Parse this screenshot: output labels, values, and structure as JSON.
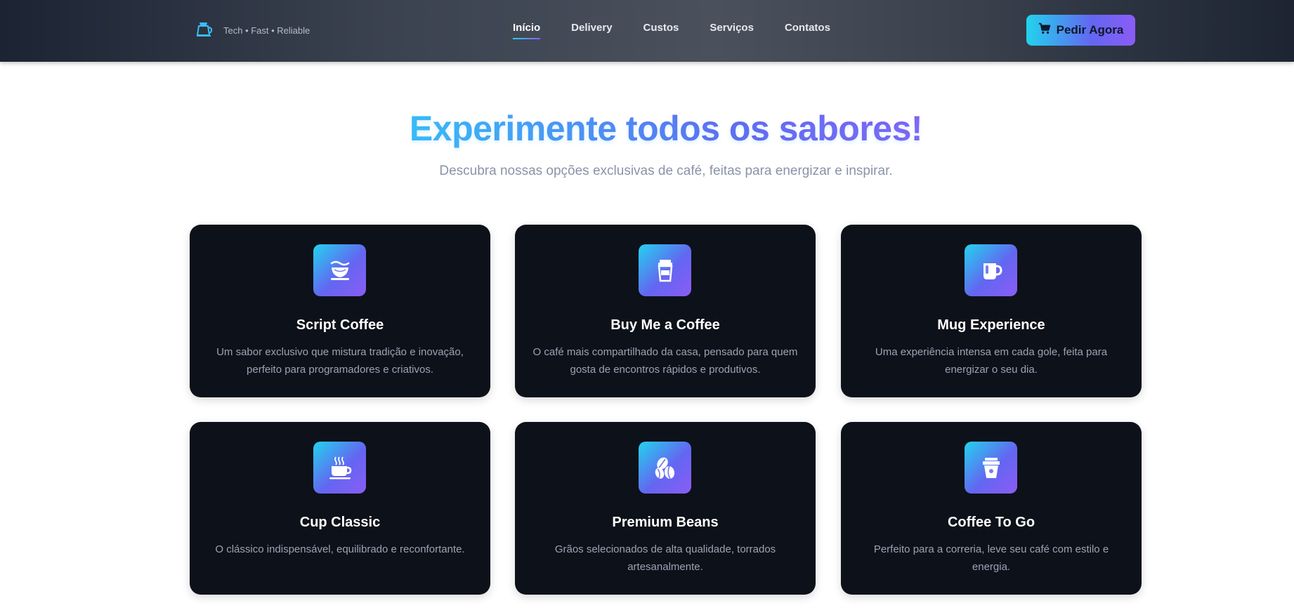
{
  "header": {
    "logo_icon": "coffee-pot-icon",
    "tagline": "Tech • Fast • Reliable",
    "nav": [
      {
        "label": "Início",
        "active": true
      },
      {
        "label": "Delivery",
        "active": false
      },
      {
        "label": "Custos",
        "active": false
      },
      {
        "label": "Serviços",
        "active": false
      },
      {
        "label": "Contatos",
        "active": false
      }
    ],
    "cta": {
      "label": "Pedir Agora",
      "icon": "cart-icon"
    }
  },
  "hero": {
    "title": "Experimente todos os sabores!",
    "subtitle": "Descubra nossas opções exclusivas de café, feitas para energizar e inspirar."
  },
  "products": [
    {
      "title": "Script Coffee",
      "description": "Um sabor exclusivo que mistura tradição e inovação, perfeito para programadores e criativos.",
      "icon": "coffee-cup-icon"
    },
    {
      "title": "Buy Me a Coffee",
      "description": "O café mais compartilhado da casa, pensado para quem gosta de encontros rápidos e produtivos.",
      "icon": "takeaway-cup-icon"
    },
    {
      "title": "Mug Experience",
      "description": "Uma experiência intensa em cada gole, feita para energizar o seu dia.",
      "icon": "mug-icon"
    },
    {
      "title": "Cup Classic",
      "description": "O clássico indispensável, equilibrado e reconfortante.",
      "icon": "steaming-cup-icon"
    },
    {
      "title": "Premium Beans",
      "description": "Grãos selecionados de alta qualidade, torrados artesanalmente.",
      "icon": "coffee-beans-icon"
    },
    {
      "title": "Coffee To Go",
      "description": "Perfeito para a correria, leve seu café com estilo e energia.",
      "icon": "to-go-cup-icon"
    }
  ],
  "colors": {
    "accent_start": "#22d3ee",
    "accent_end": "#8b5cf6",
    "card_bg": "#0d1119",
    "header_bg": "#3b4250"
  }
}
